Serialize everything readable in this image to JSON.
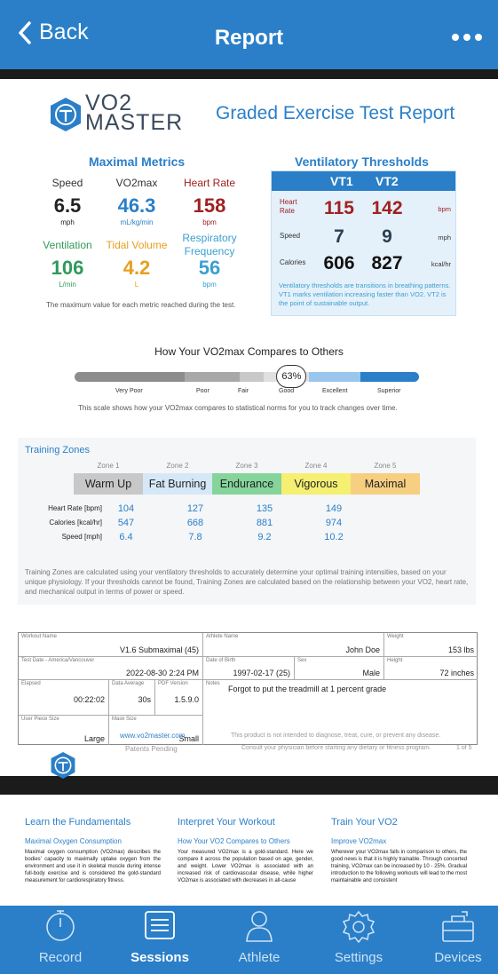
{
  "nav": {
    "back_label": "Back",
    "title": "Report"
  },
  "report": {
    "logo_line1": "VO2",
    "logo_line2": "MASTER",
    "title": "Graded Exercise Test Report",
    "maximal": {
      "title": "Maximal Metrics",
      "metrics": [
        {
          "label": "Speed",
          "value": "6.5",
          "unit": "mph",
          "color": "#222222"
        },
        {
          "label": "VO2max",
          "value": "46.3",
          "unit": "mL/kg/min",
          "color": "#2a7fc8"
        },
        {
          "label": "Heart Rate",
          "value": "158",
          "unit": "bpm",
          "color": "#a02020"
        },
        {
          "label": "Ventilation",
          "value": "106",
          "unit": "L/min",
          "color": "#2e9a5a"
        },
        {
          "label": "Tidal Volume",
          "value": "4.2",
          "unit": "L",
          "color": "#e6a020"
        },
        {
          "label": "Respiratory Frequency",
          "value": "56",
          "unit": "bpm",
          "color": "#3aa0d0"
        }
      ],
      "note": "The maximum value for each metric reached during the test."
    },
    "vt": {
      "title": "Ventilatory Thresholds",
      "h1": "VT1",
      "h2": "VT2",
      "rows": [
        {
          "label": "Heart Rate",
          "vt1": "115",
          "vt2": "142",
          "unit": "bpm",
          "color": "#a02020"
        },
        {
          "label": "Speed",
          "vt1": "7",
          "vt2": "9",
          "unit": "mph",
          "color": "#2c3e50"
        },
        {
          "label": "Calories",
          "vt1": "606",
          "vt2": "827",
          "unit": "kcal/hr",
          "color": "#111111"
        }
      ],
      "note": "Ventilatory thresholds are transitions in breathing patterns. VT1 marks ventilation increasing faster than VO2. VT2 is the point of sustainable output."
    },
    "compare": {
      "title": "How Your VO2max Compares to Others",
      "percent": "63%",
      "percent_value": 63,
      "labels": [
        "Very Poor",
        "Poor",
        "Fair",
        "Good",
        "Excellent",
        "Superior"
      ],
      "note": "This scale shows how your VO2max compares to statistical norms for you to track changes over time."
    },
    "zones": {
      "title": "Training Zones",
      "headers": [
        "Zone 1",
        "Zone 2",
        "Zone 3",
        "Zone 4",
        "Zone 5"
      ],
      "names": [
        "Warm Up",
        "Fat Burning",
        "Endurance",
        "Vigorous",
        "Maximal"
      ],
      "colors": [
        "#c8c8c8",
        "#d6e8f8",
        "#84d49c",
        "#f5ef72",
        "#f6cf80"
      ],
      "rows": [
        {
          "label": "Heart Rate [bpm]",
          "values": [
            "104",
            "127",
            "135",
            "149"
          ]
        },
        {
          "label": "Calories [kcal/hr]",
          "values": [
            "547",
            "668",
            "881",
            "974"
          ]
        },
        {
          "label": "Speed [mph]",
          "values": [
            "6.4",
            "7.8",
            "9.2",
            "10.2"
          ]
        }
      ],
      "note": "Training Zones are calculated using your ventilatory thresholds to accurately determine your optimal training intensities, based on your unique physiology. If your thresholds cannot be found, Training Zones are calculated based on the relationship between your VO2, heart rate, and mechanical output in terms of power or speed."
    },
    "info": {
      "workout_name_label": "Workout Name",
      "workout_name": "V1.6 Submaximal (45)",
      "athlete_label": "Athlete Name",
      "athlete": "John Doe",
      "weight_label": "Weight",
      "weight": "153 lbs",
      "test_date_label": "Test Date - America/Vancouver",
      "test_date": "2022-08-30 2:24 PM",
      "dob_label": "Date of Birth",
      "dob": "1997-02-17 (25)",
      "sex_label": "Sex",
      "sex": "Male",
      "height_label": "Height",
      "height": "72 inches",
      "elapsed_label": "Elapsed",
      "elapsed": "00:22:02",
      "avg_label": "Data Average",
      "avg": "30s",
      "pdf_label": "PDF Version",
      "pdf": "1.5.9.0",
      "notes_label": "Notes",
      "notes": "Forgot to put the treadmill at 1 percent grade",
      "piece_label": "User Piece Size",
      "piece": "Large",
      "mask_label": "Mask Size",
      "mask": "Small"
    },
    "footer": {
      "url": "www.vo2master.com",
      "patents": "Patents Pending",
      "disclaimer1": "This product is not intended to diagnose, treat, cure, or prevent any disease.",
      "disclaimer2": "Consult your physician before starting any dietary or fitness program.",
      "page": "1 of 5"
    },
    "page2": {
      "cols": [
        {
          "heading": "Learn the Fundamentals",
          "sub": "Maximal Oxygen Consumption",
          "body": "Maximal oxygen consumption (VO2max) describes the bodies' capacity to maximally uptake oxygen from the environment and use it in skeletal muscle during intense full-body exercise and is considered the gold-standard measurement for cardiorespiratory fitness."
        },
        {
          "heading": "Interpret Your Workout",
          "sub": "How Your VO2 Compares to Others",
          "body": "Your measured VO2max is a gold-standard. Here we compare it across the population based on age, gender, and weight. Lower VO2max is associated with an increased risk of cardiovascular disease, while higher VO2max is associated with decreases in all-cause"
        },
        {
          "heading": "Train Your VO2",
          "sub": "Improve VO2max",
          "body": "Wherever your VO2max falls in comparison to others, the good news is that it is highly trainable. Through concerted training, VO2max can be increased by 10 - 25%. Gradual introduction to the following workouts will lead to the most maintainable and consistent"
        }
      ]
    }
  },
  "tabbar": {
    "items": [
      {
        "label": "Record",
        "icon": "stopwatch-icon"
      },
      {
        "label": "Sessions",
        "icon": "list-icon"
      },
      {
        "label": "Athlete",
        "icon": "person-icon"
      },
      {
        "label": "Settings",
        "icon": "gear-icon"
      },
      {
        "label": "Devices",
        "icon": "device-case-icon"
      }
    ],
    "active": "Sessions",
    "bg": "#2a7fc8"
  }
}
